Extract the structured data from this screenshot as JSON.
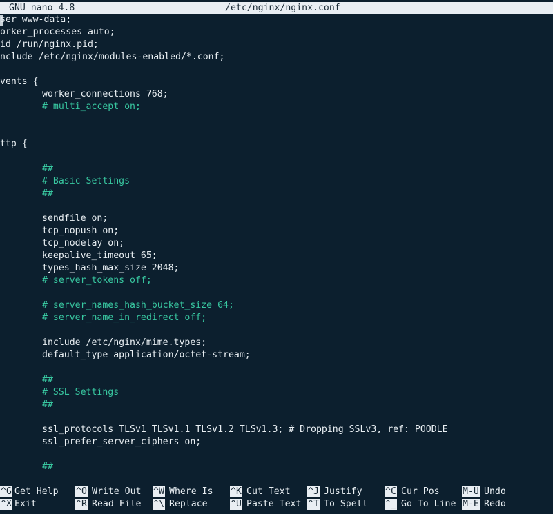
{
  "titlebar": {
    "app": "GNU nano 4.8",
    "file": "/etc/nginx/nginx.conf"
  },
  "editor": {
    "lines": [
      {
        "text": "user www-data;",
        "indent": 0,
        "comment": false
      },
      {
        "text": "worker_processes auto;",
        "indent": 0,
        "comment": false
      },
      {
        "text": "pid /run/nginx.pid;",
        "indent": 0,
        "comment": false
      },
      {
        "text": "include /etc/nginx/modules-enabled/*.conf;",
        "indent": 0,
        "comment": false
      },
      {
        "text": "",
        "indent": 0,
        "comment": false
      },
      {
        "text": "events {",
        "indent": 0,
        "comment": false
      },
      {
        "text": "worker_connections 768;",
        "indent": 1,
        "comment": false
      },
      {
        "text": "# multi_accept on;",
        "indent": 1,
        "comment": true
      },
      {
        "text": "}",
        "indent": 0,
        "comment": false
      },
      {
        "text": "",
        "indent": 0,
        "comment": false
      },
      {
        "text": "http {",
        "indent": 0,
        "comment": false
      },
      {
        "text": "",
        "indent": 0,
        "comment": false
      },
      {
        "text": "##",
        "indent": 1,
        "comment": true
      },
      {
        "text": "# Basic Settings",
        "indent": 1,
        "comment": true
      },
      {
        "text": "##",
        "indent": 1,
        "comment": true
      },
      {
        "text": "",
        "indent": 0,
        "comment": false
      },
      {
        "text": "sendfile on;",
        "indent": 1,
        "comment": false
      },
      {
        "text": "tcp_nopush on;",
        "indent": 1,
        "comment": false
      },
      {
        "text": "tcp_nodelay on;",
        "indent": 1,
        "comment": false
      },
      {
        "text": "keepalive_timeout 65;",
        "indent": 1,
        "comment": false
      },
      {
        "text": "types_hash_max_size 2048;",
        "indent": 1,
        "comment": false
      },
      {
        "text": "# server_tokens off;",
        "indent": 1,
        "comment": true
      },
      {
        "text": "",
        "indent": 0,
        "comment": false
      },
      {
        "text": "# server_names_hash_bucket_size 64;",
        "indent": 1,
        "comment": true
      },
      {
        "text": "# server_name_in_redirect off;",
        "indent": 1,
        "comment": true
      },
      {
        "text": "",
        "indent": 0,
        "comment": false
      },
      {
        "text": "include /etc/nginx/mime.types;",
        "indent": 1,
        "comment": false
      },
      {
        "text": "default_type application/octet-stream;",
        "indent": 1,
        "comment": false
      },
      {
        "text": "",
        "indent": 0,
        "comment": false
      },
      {
        "text": "##",
        "indent": 1,
        "comment": true
      },
      {
        "text": "# SSL Settings",
        "indent": 1,
        "comment": true
      },
      {
        "text": "##",
        "indent": 1,
        "comment": true
      },
      {
        "text": "",
        "indent": 0,
        "comment": false
      },
      {
        "text": "ssl_protocols TLSv1 TLSv1.1 TLSv1.2 TLSv1.3; # Dropping SSLv3, ref: POODLE",
        "indent": 1,
        "comment": false
      },
      {
        "text": "ssl_prefer_server_ciphers on;",
        "indent": 1,
        "comment": false
      },
      {
        "text": "",
        "indent": 0,
        "comment": false
      },
      {
        "text": "##",
        "indent": 1,
        "comment": true
      }
    ]
  },
  "shortcuts": [
    {
      "key": "^G",
      "label": "Get Help"
    },
    {
      "key": "^O",
      "label": "Write Out"
    },
    {
      "key": "^W",
      "label": "Where Is"
    },
    {
      "key": "^K",
      "label": "Cut Text"
    },
    {
      "key": "^J",
      "label": "Justify"
    },
    {
      "key": "^C",
      "label": "Cur Pos"
    },
    {
      "key": "M-U",
      "label": "Undo"
    },
    {
      "key": "^X",
      "label": "Exit"
    },
    {
      "key": "^R",
      "label": "Read File"
    },
    {
      "key": "^\\",
      "label": "Replace"
    },
    {
      "key": "^U",
      "label": "Paste Text"
    },
    {
      "key": "^T",
      "label": "To Spell"
    },
    {
      "key": "^_",
      "label": "Go To Line"
    },
    {
      "key": "M-E",
      "label": "Redo"
    }
  ],
  "colors": {
    "background": "#0c1f2e",
    "text": "#e8eef2",
    "comment": "#38c7a0",
    "bar": "#e9eef3"
  }
}
